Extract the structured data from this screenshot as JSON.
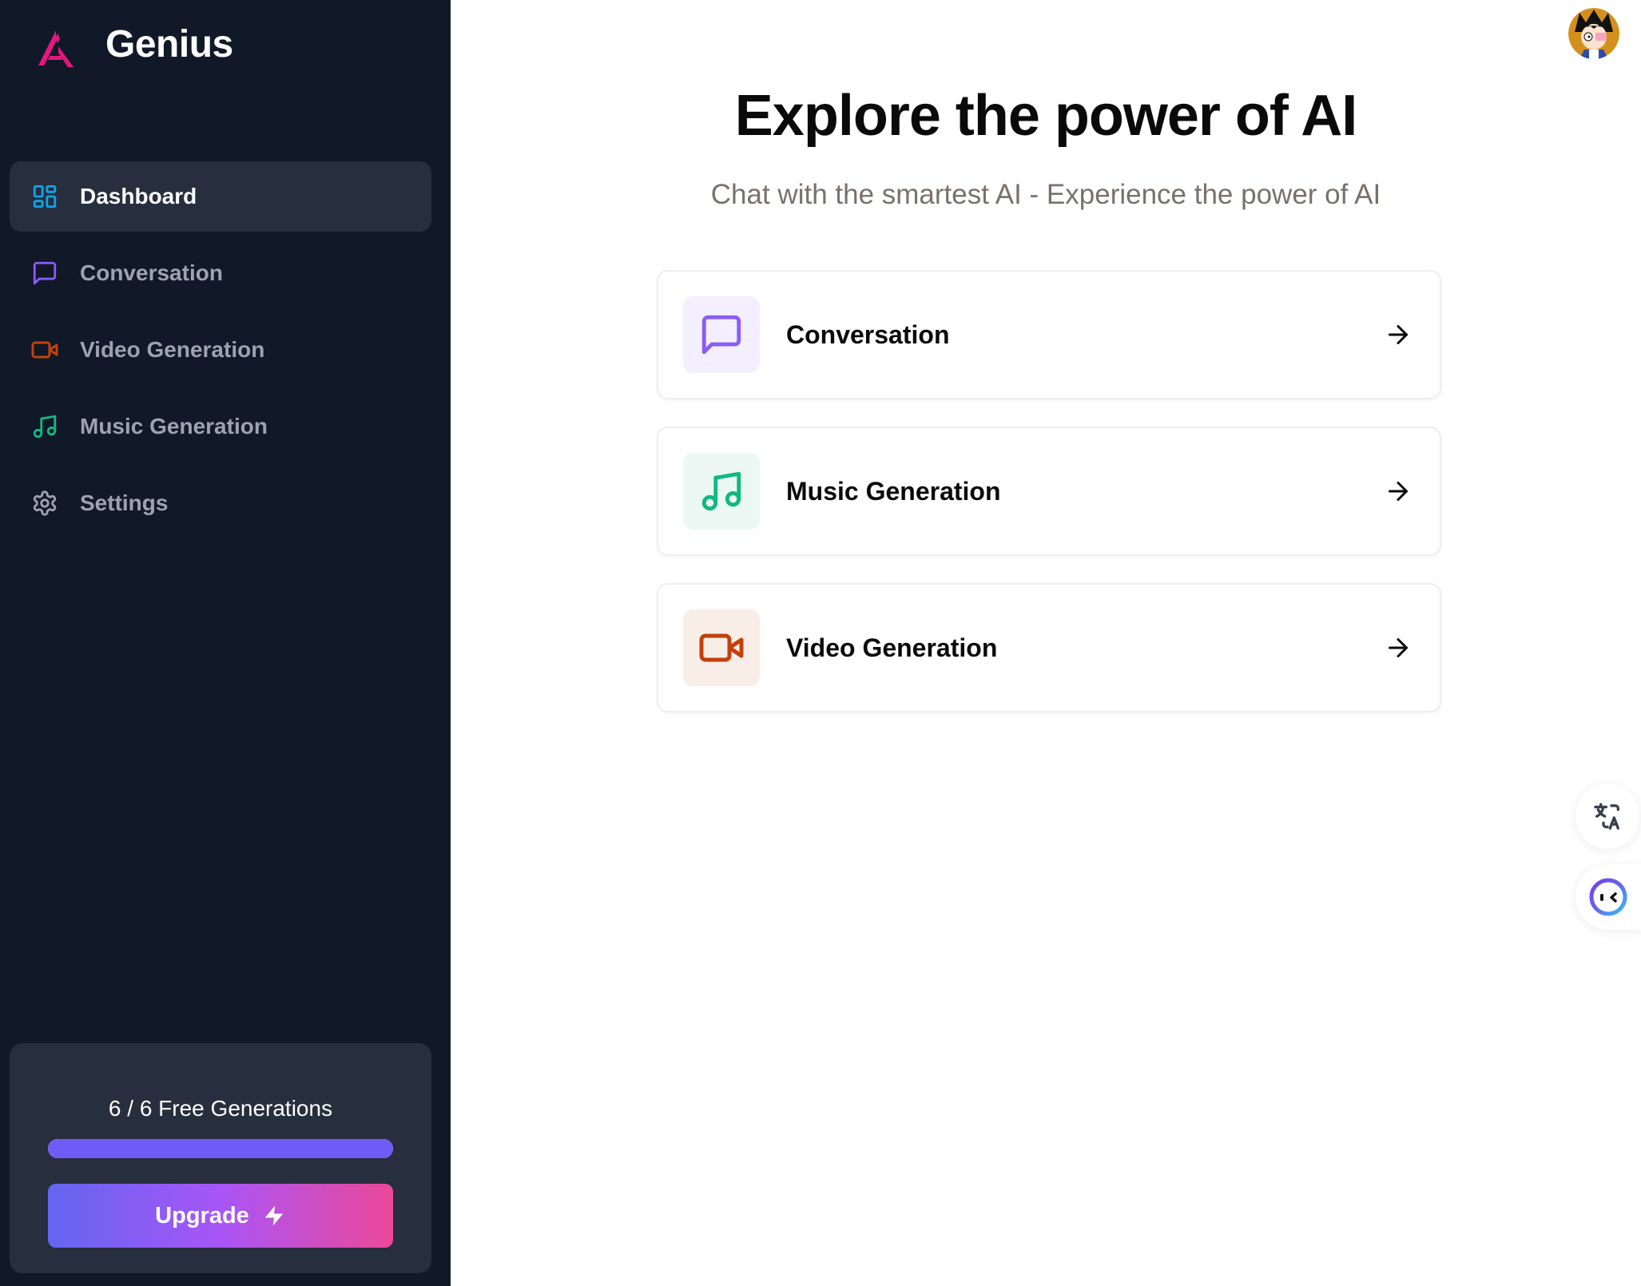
{
  "app": {
    "brand": "Genius",
    "brand_color": "#e5177f"
  },
  "sidebar": {
    "items": [
      {
        "label": "Dashboard",
        "icon": "layout-dashboard-icon",
        "color": "#0ea5e9",
        "active": true
      },
      {
        "label": "Conversation",
        "icon": "message-square-icon",
        "color": "#8b5cf6",
        "active": false
      },
      {
        "label": "Video Generation",
        "icon": "video-icon",
        "color": "#c2410c",
        "active": false
      },
      {
        "label": "Music Generation",
        "icon": "music-icon",
        "color": "#10b981",
        "active": false
      },
      {
        "label": "Settings",
        "icon": "settings-icon",
        "color": "#9ca3af",
        "active": false
      }
    ],
    "usage": {
      "text": "6 / 6 Free Generations",
      "used": 6,
      "limit": 6,
      "progress_fraction": 1.0,
      "progress_color": "#6d5cf5"
    },
    "upgrade_label": "Upgrade"
  },
  "main": {
    "title": "Explore the power of AI",
    "subtitle": "Chat with the smartest AI - Experience the power of AI",
    "tools": [
      {
        "label": "Conversation",
        "icon": "message-square-icon",
        "color": "#8b5cf6",
        "bg": "#f3effe"
      },
      {
        "label": "Music Generation",
        "icon": "music-icon",
        "color": "#10b981",
        "bg": "#ebf8f3"
      },
      {
        "label": "Video Generation",
        "icon": "video-icon",
        "color": "#c2410c",
        "bg": "#f9ede8"
      }
    ]
  },
  "floating": {
    "translate_icon": "translate-icon",
    "assistant_icon": "assistant-face-icon"
  }
}
